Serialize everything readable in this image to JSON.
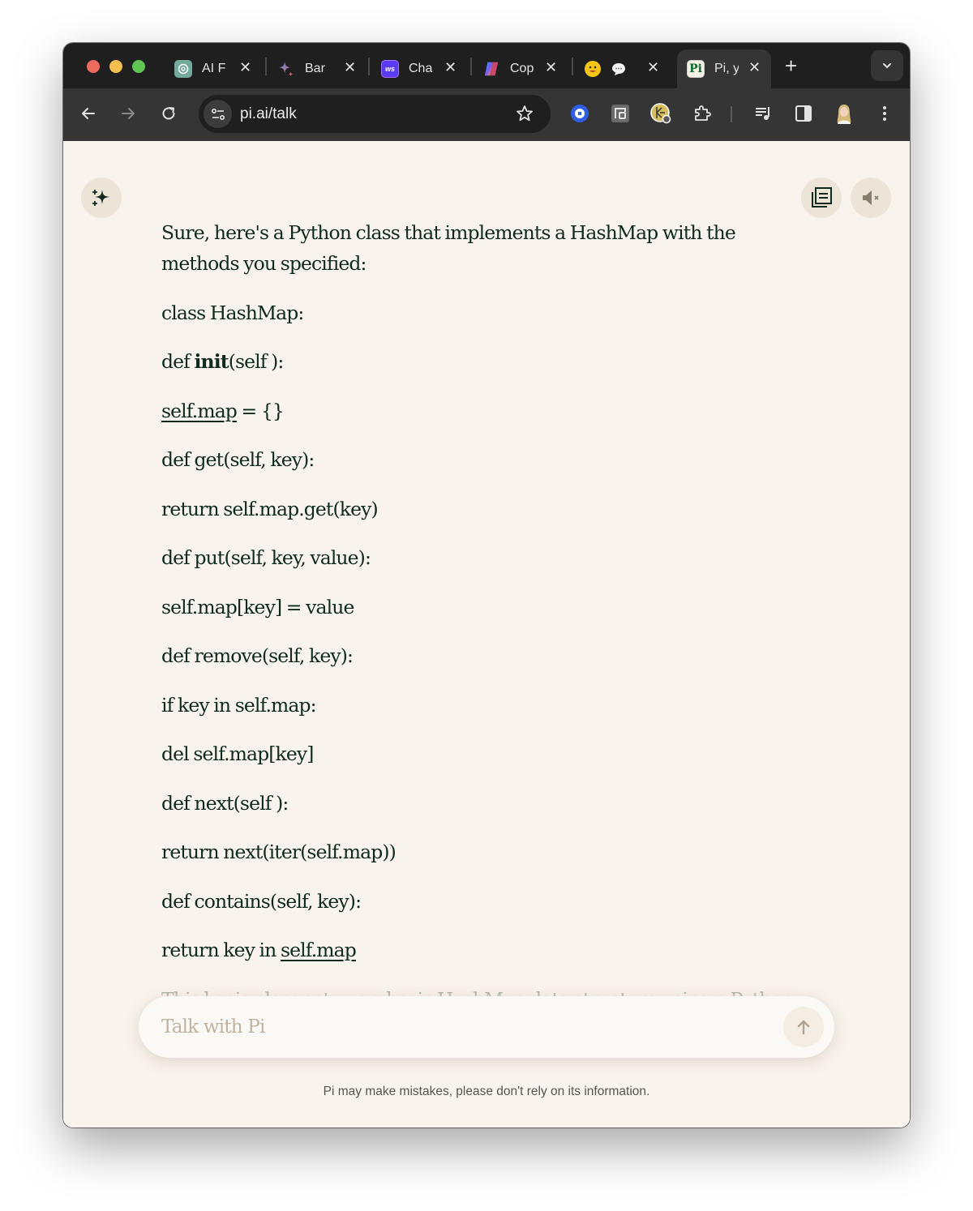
{
  "browser": {
    "tabs": [
      {
        "title": "AI F",
        "favicon": "chatgpt-icon",
        "favicon_bg": "#74aa9c"
      },
      {
        "title": "Bar",
        "favicon": "bard-sparkle-icon",
        "favicon_bg": ""
      },
      {
        "title": "Cha",
        "favicon": "ws-icon",
        "favicon_bg": "#5b3cf5"
      },
      {
        "title": "Cop",
        "favicon": "copilot-icon",
        "favicon_bg": ""
      },
      {
        "title": "",
        "favicon": "smiley-chat-icon",
        "favicon_bg": ""
      },
      {
        "title": "Pi, y",
        "favicon": "pi-icon",
        "favicon_bg": "#f5f1e6",
        "active": true
      }
    ],
    "pi_favicon_text": "Pi",
    "ws_favicon_text": "ws",
    "address": "pi.ai/talk"
  },
  "page": {
    "message_paragraphs": [
      "Sure, here's a Python class that implements a HashMap with the methods you specified:",
      "class HashMap:",
      {
        "before": "def ",
        "bold": "init",
        "after": "(self ):"
      },
      {
        "link": "self.map",
        "after": " = {}"
      },
      "def get(self, key):",
      "return self.map.get(key)",
      "def put(self, key, value):",
      "self.map[key] = value",
      "def remove(self, key):",
      "if key in self.map:",
      "del self.map[key]",
      "def next(self ):",
      "return next(iter(self.map))",
      "def contains(self, key):",
      {
        "before": "return key in ",
        "link": "self.map"
      },
      "This basic class sets up a basic HashMap data structure using a Python"
    ],
    "input_placeholder": "Talk with Pi",
    "disclaimer": "Pi may make mistakes, please don't rely on its information."
  },
  "colors": {
    "accent_dark_green": "#0e2a1c",
    "page_bg": "#f8f3ec",
    "button_bg": "#ede4d8"
  }
}
